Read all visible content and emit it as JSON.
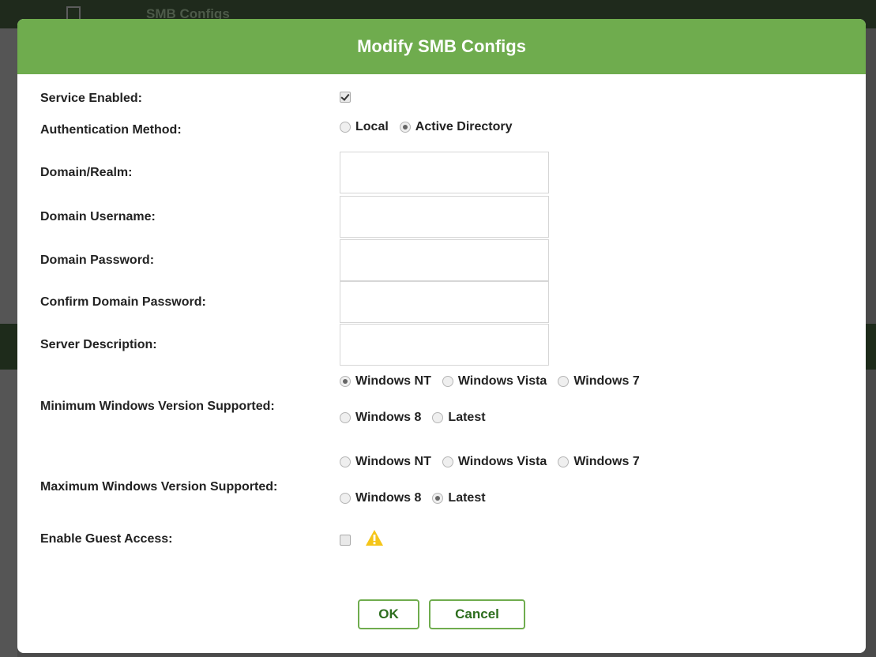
{
  "background": {
    "title": "SMB Configs"
  },
  "modal": {
    "title": "Modify SMB Configs",
    "fields": {
      "service_enabled": {
        "label": "Service Enabled:",
        "checked": true
      },
      "auth_method": {
        "label": "Authentication Method:",
        "options": [
          "Local",
          "Active Directory"
        ],
        "selected": "Active Directory"
      },
      "domain_realm": {
        "label": "Domain/Realm:",
        "value": ""
      },
      "domain_username": {
        "label": "Domain Username:",
        "value": ""
      },
      "domain_password": {
        "label": "Domain Password:",
        "value": ""
      },
      "confirm_domain_password": {
        "label": "Confirm Domain Password:",
        "value": ""
      },
      "server_description": {
        "label": "Server Description:",
        "value": ""
      },
      "min_windows": {
        "label": "Minimum Windows Version Supported:",
        "options": [
          "Windows NT",
          "Windows Vista",
          "Windows 7",
          "Windows 8",
          "Latest"
        ],
        "selected": "Windows NT"
      },
      "max_windows": {
        "label": "Maximum Windows Version Supported:",
        "options": [
          "Windows NT",
          "Windows Vista",
          "Windows 7",
          "Windows 8",
          "Latest"
        ],
        "selected": "Latest"
      },
      "guest_access": {
        "label": "Enable Guest Access:",
        "checked": false,
        "icon": "warning-icon"
      }
    },
    "buttons": {
      "ok": "OK",
      "cancel": "Cancel"
    },
    "colors": {
      "accent": "#6fac4e",
      "warning": "#f5c518"
    }
  }
}
